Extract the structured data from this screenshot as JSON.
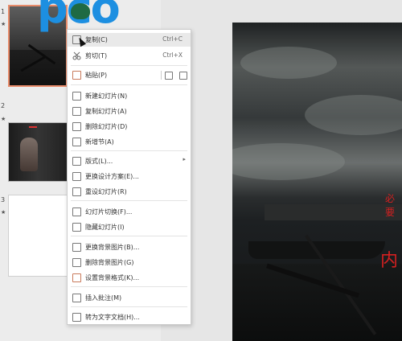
{
  "slides_pane": {
    "slides": [
      {
        "number": "1",
        "star": "★"
      },
      {
        "number": "2",
        "star": "★"
      },
      {
        "number": "3",
        "star": "★"
      }
    ]
  },
  "logo": {
    "text": "pco"
  },
  "slide_text": {
    "line1": "必要",
    "line2": "内"
  },
  "context_menu": {
    "items": [
      {
        "label": "复制(C)",
        "shortcut": "Ctrl+C",
        "icon": "copy-icon"
      },
      {
        "label": "剪切(T)",
        "shortcut": "Ctrl+X",
        "icon": "scissors-icon"
      },
      {
        "label": "粘贴(P)",
        "icon": "paste-icon"
      },
      {
        "label": "新建幻灯片(N)",
        "icon": "new-slide-icon"
      },
      {
        "label": "复制幻灯片(A)",
        "icon": "duplicate-slide-icon"
      },
      {
        "label": "删除幻灯片(D)",
        "icon": "delete-slide-icon"
      },
      {
        "label": "新增节(A)",
        "icon": "new-section-icon"
      },
      {
        "label": "版式(L)...",
        "icon": "layout-icon",
        "submenu": "▸"
      },
      {
        "label": "更换设计方案(E)...",
        "icon": "design-icon"
      },
      {
        "label": "重设幻灯片(R)",
        "icon": "reset-slide-icon"
      },
      {
        "label": "幻灯片切换(F)...",
        "icon": "transition-icon"
      },
      {
        "label": "隐藏幻灯片(I)",
        "icon": "hide-slide-icon"
      },
      {
        "label": "更换背景图片(B)...",
        "icon": "change-background-icon"
      },
      {
        "label": "删除背景图片(G)",
        "icon": "delete-background-icon"
      },
      {
        "label": "设置背景格式(K)...",
        "icon": "background-format-icon"
      },
      {
        "label": "插入批注(M)",
        "icon": "comment-icon"
      },
      {
        "label": "转为文字文档(H)...",
        "icon": "convert-doc-icon"
      }
    ]
  },
  "colors": {
    "accent_selection": "#e88b6a",
    "logo_blue": "#1d8fe1",
    "slide_red_text": "#d52020",
    "menu_hover": "#e9e9e9"
  }
}
